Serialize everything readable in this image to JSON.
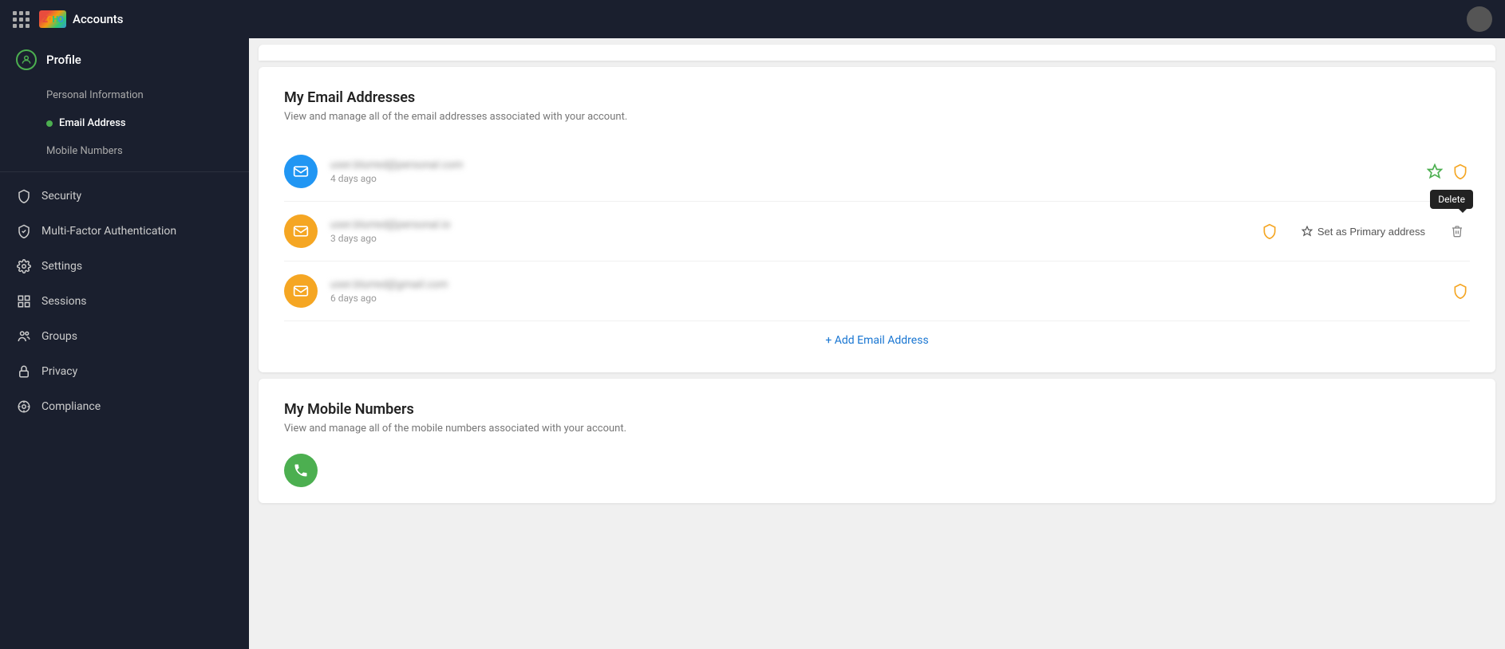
{
  "app": {
    "title": "Accounts",
    "logo": "ZOHO"
  },
  "topbar": {
    "avatar_label": "User Avatar"
  },
  "sidebar": {
    "profile_label": "Profile",
    "sub_items": [
      {
        "id": "personal-info",
        "label": "Personal Information",
        "active": false
      },
      {
        "id": "email-address",
        "label": "Email Address",
        "active": true
      },
      {
        "id": "mobile-numbers",
        "label": "Mobile Numbers",
        "active": false
      }
    ],
    "main_items": [
      {
        "id": "security",
        "label": "Security",
        "icon": "shield"
      },
      {
        "id": "mfa",
        "label": "Multi-Factor Authentication",
        "icon": "shield-check"
      },
      {
        "id": "settings",
        "label": "Settings",
        "icon": "gear"
      },
      {
        "id": "sessions",
        "label": "Sessions",
        "icon": "table"
      },
      {
        "id": "groups",
        "label": "Groups",
        "icon": "users"
      },
      {
        "id": "privacy",
        "label": "Privacy",
        "icon": "lock"
      },
      {
        "id": "compliance",
        "label": "Compliance",
        "icon": "settings-gear"
      }
    ]
  },
  "email_section": {
    "title": "My Email Addresses",
    "subtitle": "View and manage all of the email addresses associated with your account.",
    "emails": [
      {
        "id": 1,
        "address": "user1@example.com",
        "time": "4 days ago",
        "avatar_color": "blue",
        "has_crown": true,
        "has_shield": true,
        "show_actions": false
      },
      {
        "id": 2,
        "address": "user2@example.com",
        "time": "3 days ago",
        "avatar_color": "orange",
        "has_crown": false,
        "has_shield": true,
        "show_actions": true
      },
      {
        "id": 3,
        "address": "user3@gmail.com",
        "time": "6 days ago",
        "avatar_color": "orange",
        "has_crown": false,
        "has_shield": true,
        "show_actions": false
      }
    ],
    "add_label": "+ Add Email Address",
    "set_primary_label": "Set as Primary address",
    "delete_tooltip": "Delete"
  },
  "mobile_section": {
    "title": "My Mobile Numbers",
    "subtitle": "View and manage all of the mobile numbers associated with your account."
  }
}
